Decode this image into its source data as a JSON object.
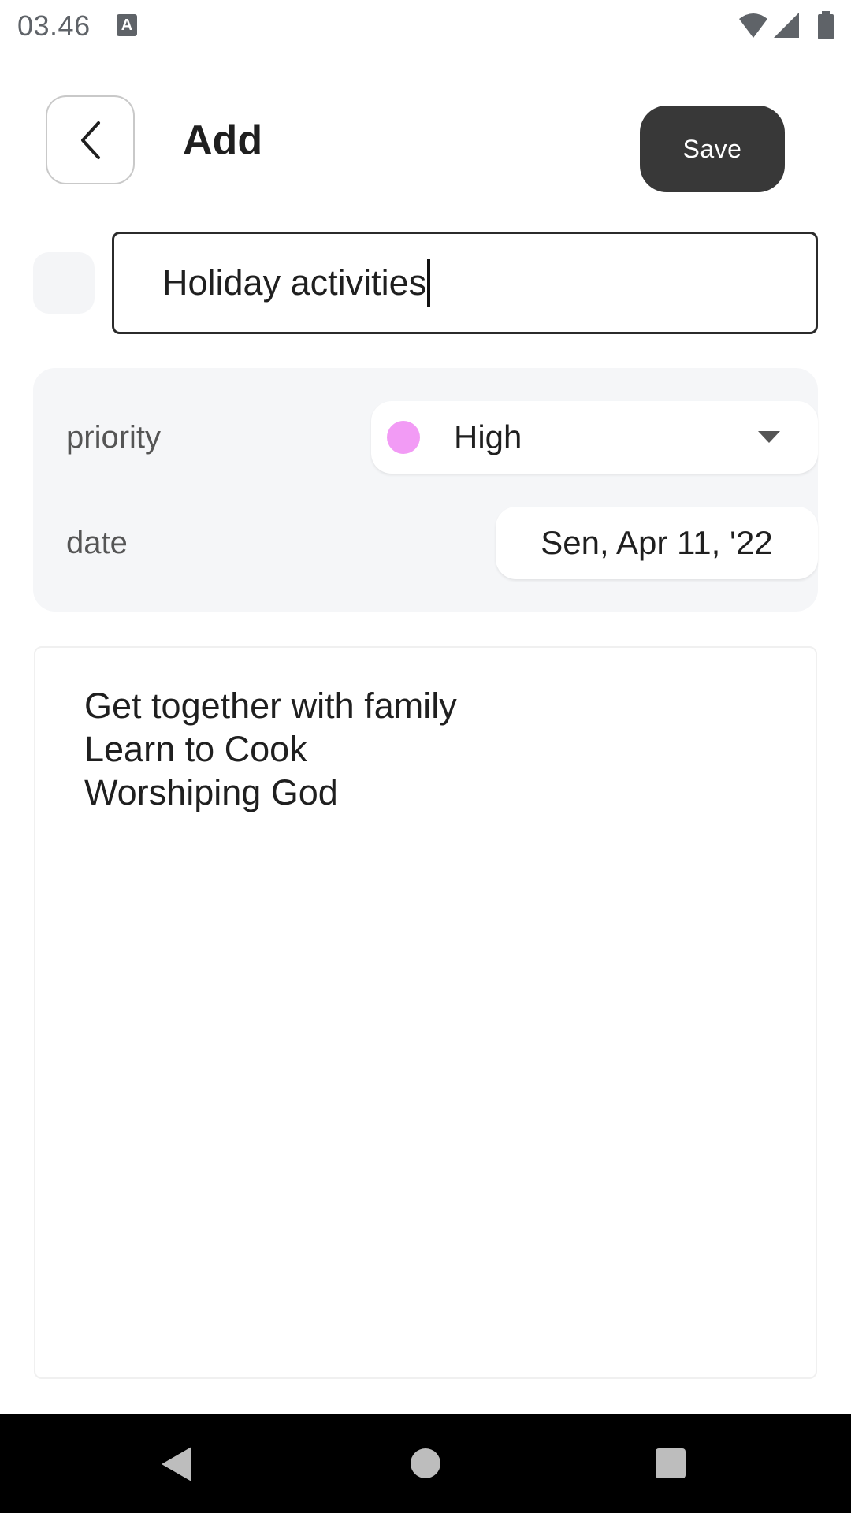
{
  "status_bar": {
    "time": "03.46",
    "notification_icon": "keyboard-a-icon",
    "icons": [
      "wifi-icon",
      "signal-icon",
      "battery-icon"
    ]
  },
  "header": {
    "back_icon": "chevron-left-icon",
    "title": "Add",
    "save_label": "Save"
  },
  "task": {
    "icon_placeholder": "task-icon-placeholder",
    "title_value": "Holiday activities"
  },
  "settings": {
    "priority_label": "priority",
    "priority_value": "High",
    "priority_color": "#f29bf5",
    "date_label": "date",
    "date_value": "Sen, Apr 11, '22"
  },
  "notes": {
    "lines": [
      "Get together with family",
      "Learn to Cook",
      "Worshiping God"
    ]
  },
  "nav_bar": {
    "icons": [
      "nav-back-icon",
      "nav-home-icon",
      "nav-recents-icon"
    ]
  }
}
